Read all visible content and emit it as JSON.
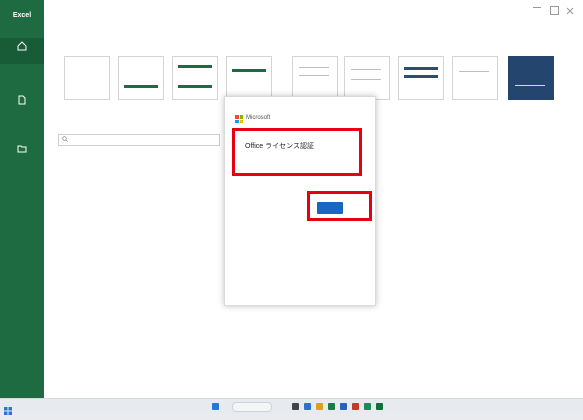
{
  "window": {
    "title": ""
  },
  "rail": {
    "brand": "Excel",
    "items": [
      {
        "label": ""
      },
      {
        "label": ""
      },
      {
        "label": ""
      }
    ],
    "footer": [
      {
        "label": ""
      },
      {
        "label": ""
      },
      {
        "label": ""
      }
    ]
  },
  "home": {
    "section_title": "",
    "templates": [
      {
        "label": ""
      },
      {
        "label": ""
      },
      {
        "label": ""
      },
      {
        "label": ""
      },
      {
        "label": ""
      },
      {
        "label": ""
      },
      {
        "label": ""
      },
      {
        "label": ""
      }
    ],
    "more_templates": "",
    "search_placeholder": "",
    "tabs": [
      {
        "label": ""
      },
      {
        "label": ""
      },
      {
        "label": ""
      }
    ],
    "empty_note": "",
    "more_files": ""
  },
  "dialog": {
    "brand": "Microsoft",
    "title": "Office ライセンス認証",
    "subtitle": "",
    "line1": "",
    "line2": "",
    "button": "",
    "middle_mark": "",
    "footer": ""
  },
  "taskbar": {
    "search_placeholder": "",
    "clock": ""
  },
  "colors": {
    "excel_green": "#1e6b41",
    "accent_blue": "#1a66c4",
    "highlight_red": "#e60012"
  }
}
